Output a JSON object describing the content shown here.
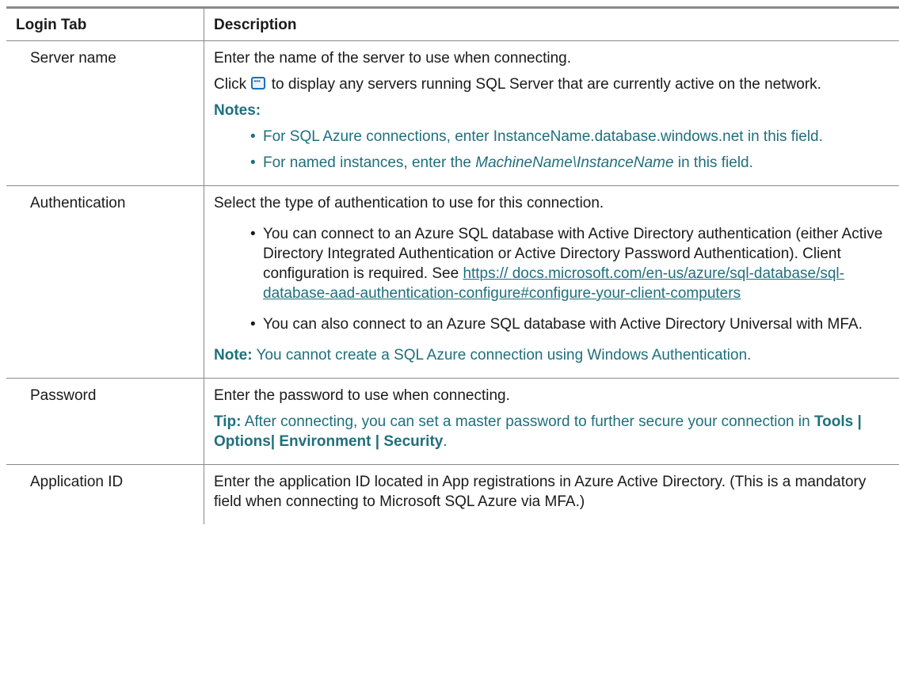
{
  "table": {
    "header_left": "Login Tab",
    "header_right": "Description"
  },
  "server": {
    "label": "Server name",
    "p1": "Enter the name of the server to use when connecting.",
    "p2_before": "Click",
    "p2_after": "to display any servers running SQL Server that are currently active on the network.",
    "icon": "ellipsis-button-icon",
    "notes_label": "Notes:",
    "note_item1": "For SQL Azure connections, enter InstanceName.database.windows.net in this field.",
    "note_item2_before": "For named instances, enter the",
    "note_item2_italic": "MachineName\\InstanceName",
    "note_item2_after": "in this field."
  },
  "authentication": {
    "label": "Authentication",
    "p1": "Select the type of authentication to use for this connection.",
    "item1_text": "You can connect to an Azure SQL database with Active Directory authentication (either Active Directory Integrated Authentication or Active Directory Password Authentication). Client configuration is required. See",
    "item1_link": "https:// docs.microsoft.com/en-us/azure/sql-database/sql-database-aad-authentication-configure#configure-your-client-computers",
    "item2_text": "You can also connect to an Azure SQL database with Active Directory Universal with MFA.",
    "note_label": "Note:",
    "note_text": "You cannot create a SQL Azure connection using Windows Authentication."
  },
  "password": {
    "label": "Password",
    "p1": "Enter the password to use when connecting.",
    "tip_label": "Tip:",
    "tip_text": "After connecting, you can set a master password to further secure your connection in",
    "tip_path": "Tools | Options| Environment | Security",
    "tip_end": "."
  },
  "application_id": {
    "label": "Application ID",
    "p1": "Enter the application ID located in App registrations in Azure Active Directory. (This is a mandatory field when connecting to Microsoft SQL Azure via MFA.)"
  },
  "colors": {
    "note_teal": "#1f6f7d",
    "border_gray": "#8a8a8a",
    "icon_blue": "#1f6fb8"
  }
}
